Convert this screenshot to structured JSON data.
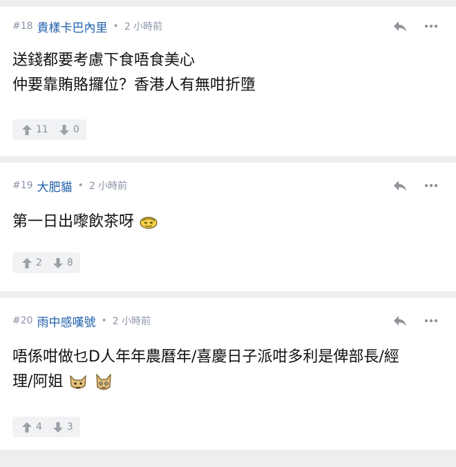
{
  "posts": [
    {
      "number": "#18",
      "user": "貴樣卡巴內里",
      "time": "2 小時前",
      "lines": [
        "送錢都要考慮下食唔食美心",
        "仲要靠賄賂攞位？香港人有無咁折墮"
      ],
      "up": "11",
      "down": "0"
    },
    {
      "number": "#19",
      "user": "大肥貓",
      "time": "2 小時前",
      "lines": [
        "第一日出嚟飲茶呀"
      ],
      "up": "2",
      "down": "8"
    },
    {
      "number": "#20",
      "user": "雨中感嘆號",
      "time": "2 小時前",
      "lines": [
        "唔係咁做乜D人年年農曆年/喜慶日子派咁多利是俾部長/經",
        "理/阿姐"
      ],
      "up": "4",
      "down": "3"
    }
  ],
  "separator": "•",
  "icons": {
    "reply": "reply-icon",
    "more": "more-icon",
    "upvote": "arrow-up-icon",
    "downvote": "arrow-down-icon"
  },
  "colors": {
    "username": "#1e5fa8",
    "meta": "#8a94a6",
    "background": "#eeeeee",
    "vote_bg": "#f1f2f4"
  }
}
